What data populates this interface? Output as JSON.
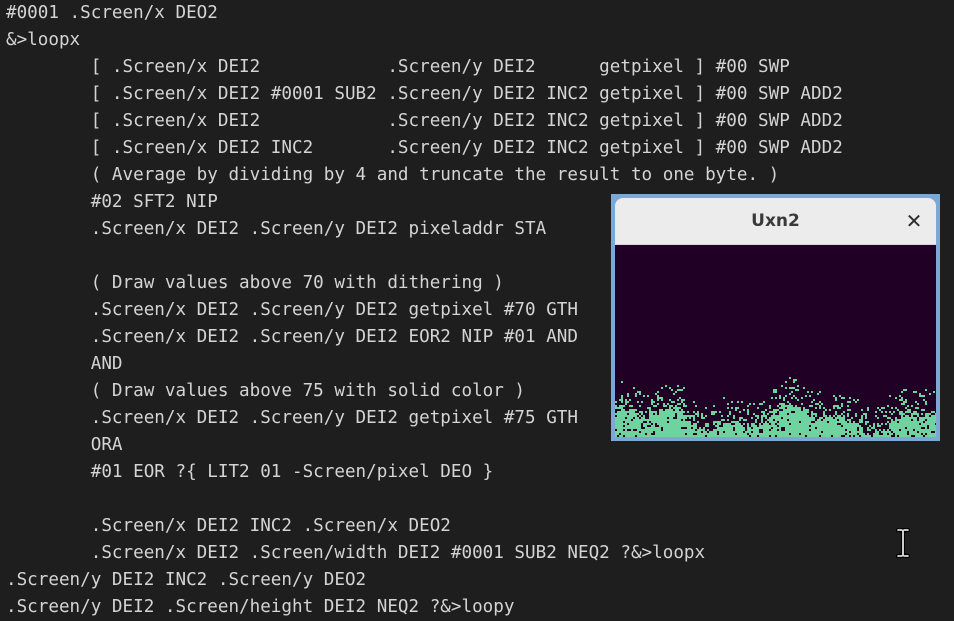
{
  "editor": {
    "lines": [
      "#0001 .Screen/x DEO2",
      "&>loopx",
      "        [ .Screen/x DEI2            .Screen/y DEI2      getpixel ] #00 SWP",
      "        [ .Screen/x DEI2 #0001 SUB2 .Screen/y DEI2 INC2 getpixel ] #00 SWP ADD2",
      "        [ .Screen/x DEI2            .Screen/y DEI2 INC2 getpixel ] #00 SWP ADD2",
      "        [ .Screen/x DEI2 INC2       .Screen/y DEI2 INC2 getpixel ] #00 SWP ADD2",
      "        ( Average by dividing by 4 and truncate the result to one byte. )",
      "        #02 SFT2 NIP",
      "        .Screen/x DEI2 .Screen/y DEI2 pixeladdr STA",
      "",
      "        ( Draw values above 70 with dithering )",
      "        .Screen/x DEI2 .Screen/y DEI2 getpixel #70 GTH",
      "        .Screen/x DEI2 .Screen/y DEI2 EOR2 NIP #01 AND",
      "        AND",
      "        ( Draw values above 75 with solid color )",
      "        .Screen/x DEI2 .Screen/y DEI2 getpixel #75 GTH",
      "        ORA",
      "        #01 EOR ?{ LIT2 01 -Screen/pixel DEO }",
      "",
      "        .Screen/x DEI2 INC2 .Screen/x DEO2",
      "        .Screen/x DEI2 .Screen/width DEI2 #0001 SUB2 NEQ2 ?&>loopx",
      ".Screen/y DEI2 INC2 .Screen/y DEO2",
      ".Screen/y DEI2 .Screen/height DEI2 NEQ2 ?&>loopy"
    ]
  },
  "window": {
    "title": "Uxn2",
    "close_glyph": "✕",
    "colors": {
      "frame": "#7ba9d6",
      "titlebar": "#ececec",
      "background": "#200024",
      "fire": "#6fd3a0"
    }
  },
  "cursor": {
    "icon": "text-ibeam-cursor-icon"
  }
}
